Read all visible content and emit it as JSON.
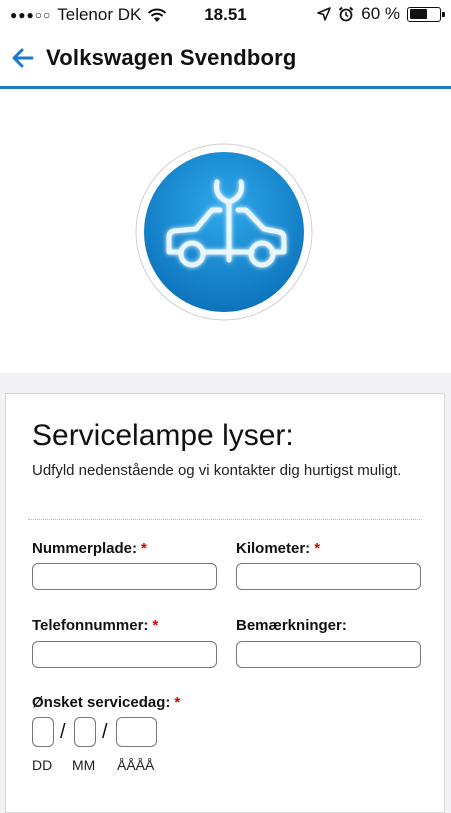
{
  "status_bar": {
    "carrier": "Telenor DK",
    "time": "18.51",
    "battery": "60 %",
    "battery_level": 0.6
  },
  "nav": {
    "title": "Volkswagen Svendborg"
  },
  "hero": {
    "icon": "car-service-wrench-icon",
    "accent": "#1a7ad0"
  },
  "form": {
    "title": "Servicelampe lyser:",
    "intro": "Udfyld nedenstående og vi kontakter dig hurtigst muligt.",
    "required_marker": "*",
    "fields": {
      "nummerplade": {
        "label": "Nummerplade:",
        "value": ""
      },
      "kilometer": {
        "label": "Kilometer:",
        "value": ""
      },
      "telefonnummer": {
        "label": "Telefonnummer:",
        "value": ""
      },
      "bemaerkninger": {
        "label": "Bemærkninger:",
        "value": ""
      }
    },
    "date": {
      "label": "Ønsket servicedag:",
      "separator": "/",
      "dd": "DD",
      "mm": "MM",
      "yyyy": "ÅÅÅÅ"
    }
  }
}
